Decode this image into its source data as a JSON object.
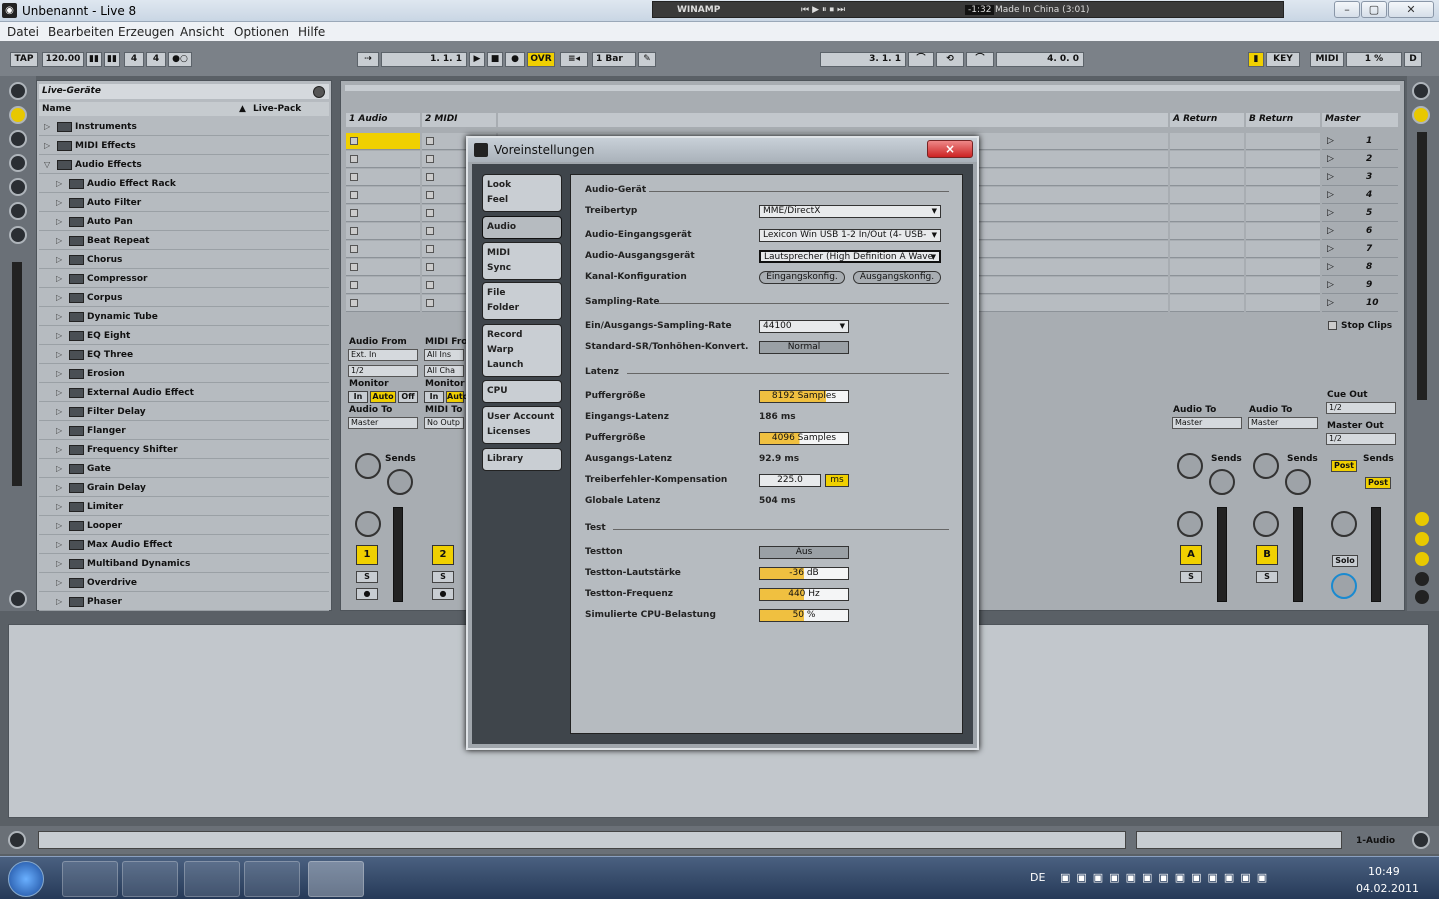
{
  "window": {
    "title": "Unbenannt - Live 8"
  },
  "winamp": {
    "label": "WINAMP",
    "time": "-1:32",
    "track": "Made In China (3:01)"
  },
  "menu": [
    "Datei",
    "Bearbeiten",
    "Erzeugen",
    "Ansicht",
    "Optionen",
    "Hilfe"
  ],
  "control": {
    "tap": "TAP",
    "tempo": "120.00",
    "signature_num": "4",
    "signature_den": "4",
    "position": "1.   1.   1",
    "ovr": "OVR",
    "quantize": "1 Bar",
    "loop_start": "3.   1.   1",
    "loop_length": "4.   0.   0",
    "key": "KEY",
    "midi": "MIDI",
    "cpu": "1 %",
    "d": "D"
  },
  "browser": {
    "title": "Live-Geräte",
    "col_name": "Name",
    "col_pack": "Live-Pack",
    "items": [
      {
        "label": "Instruments",
        "level": 0,
        "open": false
      },
      {
        "label": "MIDI Effects",
        "level": 0,
        "open": false
      },
      {
        "label": "Audio Effects",
        "level": 0,
        "open": true
      },
      {
        "label": "Audio Effect Rack",
        "level": 1
      },
      {
        "label": "Auto Filter",
        "level": 1
      },
      {
        "label": "Auto Pan",
        "level": 1
      },
      {
        "label": "Beat Repeat",
        "level": 1
      },
      {
        "label": "Chorus",
        "level": 1
      },
      {
        "label": "Compressor",
        "level": 1
      },
      {
        "label": "Corpus",
        "level": 1
      },
      {
        "label": "Dynamic Tube",
        "level": 1
      },
      {
        "label": "EQ Eight",
        "level": 1
      },
      {
        "label": "EQ Three",
        "level": 1
      },
      {
        "label": "Erosion",
        "level": 1
      },
      {
        "label": "External Audio Effect",
        "level": 1
      },
      {
        "label": "Filter Delay",
        "level": 1
      },
      {
        "label": "Flanger",
        "level": 1
      },
      {
        "label": "Frequency Shifter",
        "level": 1
      },
      {
        "label": "Gate",
        "level": 1
      },
      {
        "label": "Grain Delay",
        "level": 1
      },
      {
        "label": "Limiter",
        "level": 1
      },
      {
        "label": "Looper",
        "level": 1
      },
      {
        "label": "Max Audio Effect",
        "level": 1
      },
      {
        "label": "Multiband Dynamics",
        "level": 1
      },
      {
        "label": "Overdrive",
        "level": 1
      },
      {
        "label": "Phaser",
        "level": 1
      }
    ]
  },
  "session": {
    "tracks": [
      "1 Audio",
      "2 MIDI"
    ],
    "returns": [
      "A Return",
      "B Return"
    ],
    "master": "Master",
    "scenes": [
      "1",
      "2",
      "3",
      "4",
      "5",
      "6",
      "7",
      "8",
      "9",
      "10"
    ],
    "stop_clips": "Stop Clips",
    "audio_from": "Audio From",
    "ext_in": "Ext. In",
    "input_ch": "1/2",
    "midi_from": "MIDI From",
    "all_ins": "All Ins",
    "all_channels": "All Cha",
    "monitor": "Monitor",
    "mon_in": "In",
    "mon_auto": "Auto",
    "mon_off": "Off",
    "audio_to": "Audio To",
    "midi_to": "MIDI To",
    "out_master": "Master",
    "no_output": "No Outp",
    "sends": "Sends",
    "knob_a": "A",
    "knob_b": "B",
    "cue_out": "Cue Out",
    "cue_ch": "1/2",
    "master_out": "Master Out",
    "master_ch": "1/2",
    "post": "Post",
    "solo": "Solo",
    "s": "S",
    "track1_num": "1",
    "track2_num": "2",
    "ret_a": "A",
    "ret_b": "B"
  },
  "bottom": {
    "status": "1-Audio"
  },
  "taskbar": {
    "lang": "DE",
    "time": "10:49",
    "date": "04.02.2011"
  },
  "dialog": {
    "title": "Voreinstellungen",
    "close": "×",
    "nav": [
      {
        "label": "Look\nFeel",
        "selected": false
      },
      {
        "label": "Audio",
        "selected": true
      },
      {
        "label": "MIDI\nSync",
        "selected": false
      },
      {
        "label": "File\nFolder",
        "selected": false
      },
      {
        "label": "Record\nWarp\nLaunch",
        "selected": false
      },
      {
        "label": "CPU",
        "selected": false
      },
      {
        "label": "User Account\nLicenses",
        "selected": false
      },
      {
        "label": "Library",
        "selected": false
      }
    ],
    "sec_device": "Audio-Gerät",
    "driver_type_label": "Treibertyp",
    "driver_type": "MME/DirectX",
    "input_device_label": "Audio-Eingangsgerät",
    "input_device": "Lexicon Win USB 1-2 In/Out (4- USB-",
    "output_device_label": "Audio-Ausgangsgerät",
    "output_device": "Lautsprecher (High Definition A Wave",
    "channel_config_label": "Kanal-Konfiguration",
    "input_config": "Eingangskonfig.",
    "output_config": "Ausgangskonfig.",
    "sec_sampling": "Sampling-Rate",
    "sample_rate_label": "Ein/Ausgangs-Sampling-Rate",
    "sample_rate": "44100",
    "src_label": "Standard-SR/Tonhöhen-Konvert.",
    "src_value": "Normal",
    "sec_latency": "Latenz",
    "buffer_in_label": "Puffergröße",
    "buffer_in": "8192 Samples",
    "buffer_in_fill": 0.75,
    "input_latency_label": "Eingangs-Latenz",
    "input_latency": "186 ms",
    "buffer_out_label": "Puffergröße",
    "buffer_out": "4096 Samples",
    "buffer_out_fill": 0.45,
    "output_latency_label": "Ausgangs-Latenz",
    "output_latency": "92.9 ms",
    "driver_comp_label": "Treiberfehler-Kompensation",
    "driver_comp": "225.0",
    "driver_comp_unit": "ms",
    "overall_latency_label": "Globale Latenz",
    "overall_latency": "504 ms",
    "sec_test": "Test",
    "test_tone_label": "Testton",
    "test_tone": "Aus",
    "test_volume_label": "Testton-Lautstärke",
    "test_volume": "-36 dB",
    "test_volume_fill": 0.5,
    "test_freq_label": "Testton-Frequenz",
    "test_freq": "440 Hz",
    "test_freq_fill": 0.5,
    "cpu_load_label": "Simulierte CPU-Belastung",
    "cpu_load": "50 %",
    "cpu_load_fill": 0.5
  }
}
